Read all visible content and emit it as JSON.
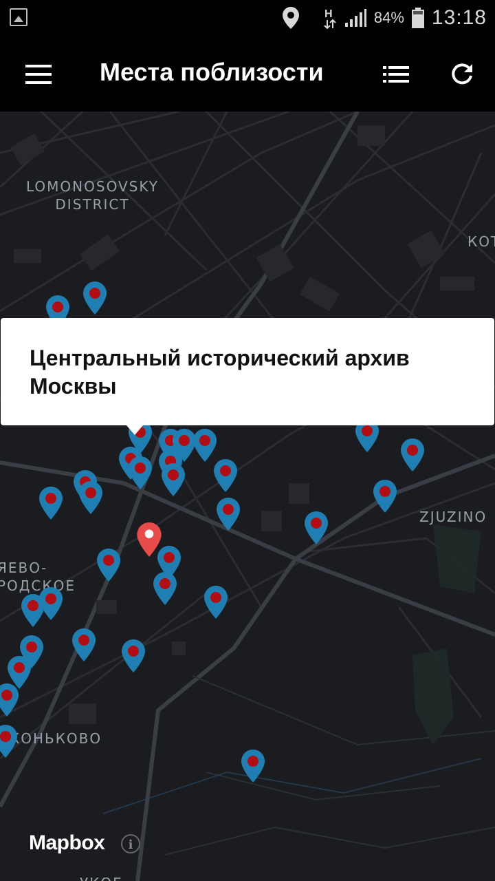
{
  "status_bar": {
    "icons": [
      "gallery-icon",
      "location-icon",
      "h-network-icon",
      "signal-icon",
      "battery-icon"
    ],
    "battery": "84%",
    "time": "13:18"
  },
  "app_bar": {
    "title": "Места поблизости",
    "icons": [
      "menu-icon",
      "list-icon",
      "refresh-icon"
    ]
  },
  "map": {
    "districts": [
      {
        "id": "lomonosovsky",
        "label": "LOMONOSOVSKY\nDISTRICT"
      },
      {
        "id": "kot",
        "label": "КОТ"
      },
      {
        "id": "zjuzino",
        "label": "ZJUZINO"
      },
      {
        "id": "cheremushki",
        "label": "ЯЕВО-\nРОДСКОЕ"
      },
      {
        "id": "konkovo",
        "label": "КОНЬКОВО"
      },
      {
        "id": "bottom",
        "label": "УКОЕ"
      }
    ],
    "selected_marker_color": "#e94b4b",
    "marker_color": "#1f7fb3",
    "marker_dot_color": "#b20d12",
    "attribution": "Mapbox"
  },
  "popup": {
    "title": "Центральный исторический архив Москвы"
  }
}
